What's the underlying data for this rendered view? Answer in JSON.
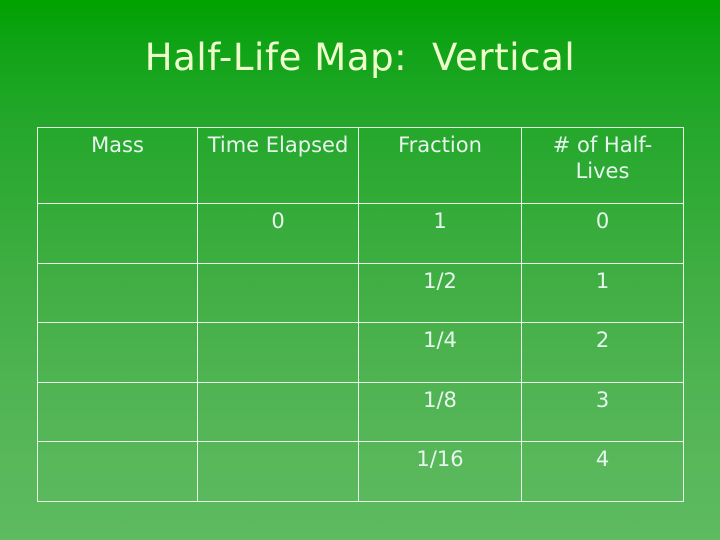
{
  "slide": {
    "title": "Half-Life Map:  Vertical",
    "background": {
      "gradient_top": "#00a200",
      "gradient_bottom": "#5ebb60"
    },
    "title_color": "#eeffcc",
    "table_text_color": "#e6f6ee",
    "table_border_color": "#e9f7e9"
  },
  "table": {
    "columns": [
      {
        "key": "mass",
        "label": "Mass"
      },
      {
        "key": "time",
        "label": "Time\nElapsed"
      },
      {
        "key": "fraction",
        "label": "Fraction"
      },
      {
        "key": "halflives",
        "label": "# of Half-\nLives"
      }
    ],
    "rows": [
      {
        "mass": "",
        "time": "0",
        "fraction": "1",
        "halflives": "0"
      },
      {
        "mass": "",
        "time": "",
        "fraction": "1/2",
        "halflives": "1"
      },
      {
        "mass": "",
        "time": "",
        "fraction": "1/4",
        "halflives": "2"
      },
      {
        "mass": "",
        "time": "",
        "fraction": "1/8",
        "halflives": "3"
      },
      {
        "mass": "",
        "time": "",
        "fraction": "1/16",
        "halflives": "4"
      }
    ]
  }
}
